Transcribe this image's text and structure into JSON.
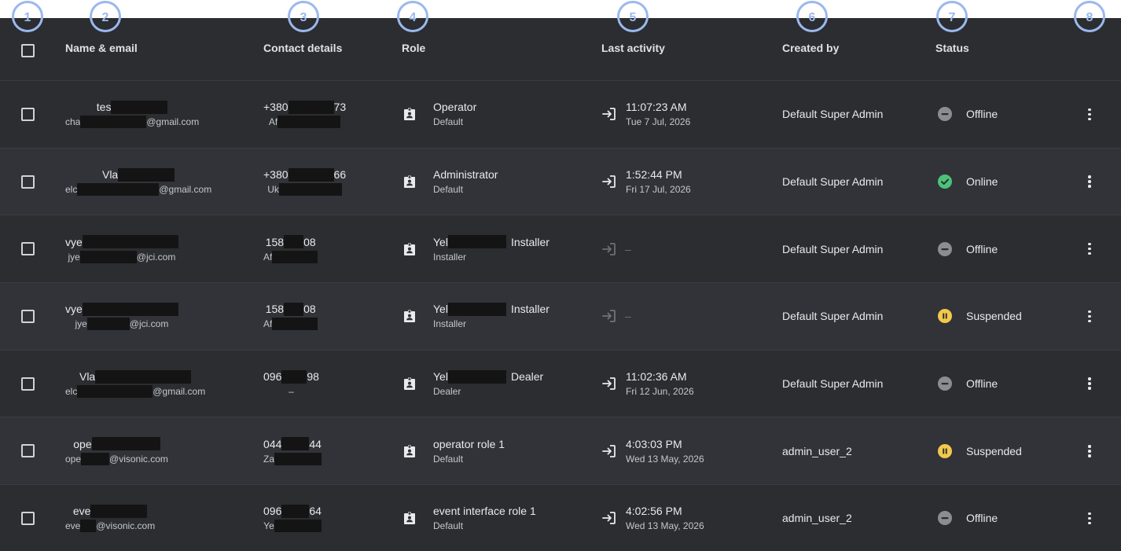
{
  "badges": [
    "1",
    "2",
    "3",
    "4",
    "5",
    "6",
    "7",
    "8"
  ],
  "headers": {
    "name": "Name & email",
    "contact": "Contact details",
    "role": "Role",
    "activity": "Last activity",
    "created_by": "Created by",
    "status": "Status"
  },
  "rows": [
    {
      "name_prefix": "tes",
      "email_prefix": "cha",
      "email_domain": "@gmail.com",
      "phone_start": "+380",
      "phone_end": "73",
      "country": "Af",
      "role_prefix": "Operator",
      "role_suffix": "",
      "role_sub": "Default",
      "time": "11:07:23 AM",
      "date": "Tue 7 Jul, 2026",
      "created_by": "Default Super Admin",
      "status": "Offline",
      "status_kind": "offline"
    },
    {
      "name_prefix": "Vla",
      "email_prefix": "elc",
      "email_domain": "@gmail.com",
      "phone_start": "+380",
      "phone_end": "66",
      "country": "Uk",
      "role_prefix": "Administrator",
      "role_suffix": "",
      "role_sub": "Default",
      "time": "1:52:44 PM",
      "date": "Fri 17 Jul, 2026",
      "created_by": "Default Super Admin",
      "status": "Online",
      "status_kind": "online"
    },
    {
      "name_prefix": "vye",
      "email_prefix": "jye",
      "email_domain": "@jci.com",
      "phone_start": "158",
      "phone_end": "08",
      "country": "Af",
      "role_prefix": "Yel",
      "role_suffix": "Installer",
      "role_sub": "Installer",
      "time": "",
      "date": "",
      "no_activity": "–",
      "created_by": "Default Super Admin",
      "status": "Offline",
      "status_kind": "offline"
    },
    {
      "name_prefix": "vye",
      "email_prefix": "jye",
      "email_domain": "@jci.com",
      "phone_start": "158",
      "phone_end": "08",
      "country": "Af",
      "role_prefix": "Yel",
      "role_suffix": "Installer",
      "role_sub": "Installer",
      "time": "",
      "date": "",
      "no_activity": "–",
      "created_by": "Default Super Admin",
      "status": "Suspended",
      "status_kind": "suspended"
    },
    {
      "name_prefix": "Vla",
      "email_prefix": "elc",
      "email_domain": "@gmail.com",
      "phone_start": "096",
      "phone_end": "98",
      "country": "–",
      "role_prefix": "Yel",
      "role_suffix": "Dealer",
      "role_sub": "Dealer",
      "time": "11:02:36 AM",
      "date": "Fri 12 Jun, 2026",
      "created_by": "Default Super Admin",
      "status": "Offline",
      "status_kind": "offline"
    },
    {
      "name_prefix": "ope",
      "email_prefix": "ope",
      "email_domain": "@visonic.com",
      "phone_start": "044",
      "phone_end": "44",
      "country": "Za",
      "role_prefix": "operator role 1",
      "role_suffix": "",
      "role_sub": "Default",
      "time": "4:03:03 PM",
      "date": "Wed 13 May, 2026",
      "created_by": "admin_user_2",
      "status": "Suspended",
      "status_kind": "suspended"
    },
    {
      "name_prefix": "eve",
      "email_prefix": "eve",
      "email_domain": "@visonic.com",
      "phone_start": "096",
      "phone_end": "64",
      "country": "Ye",
      "role_prefix": "event interface role 1",
      "role_suffix": "",
      "role_sub": "Default",
      "time": "4:02:56 PM",
      "date": "Wed 13 May, 2026",
      "created_by": "admin_user_2",
      "status": "Offline",
      "status_kind": "offline"
    }
  ],
  "icons": {
    "role": "badge-icon",
    "activity": "login-icon",
    "menu": "more-vertical-icon"
  },
  "colors": {
    "background": "#2b2d31",
    "row_alt": "#313338",
    "offline": "#8a8d92",
    "online": "#4cc27a",
    "suspended": "#f2c94c",
    "badge": "#9bb8ee"
  }
}
